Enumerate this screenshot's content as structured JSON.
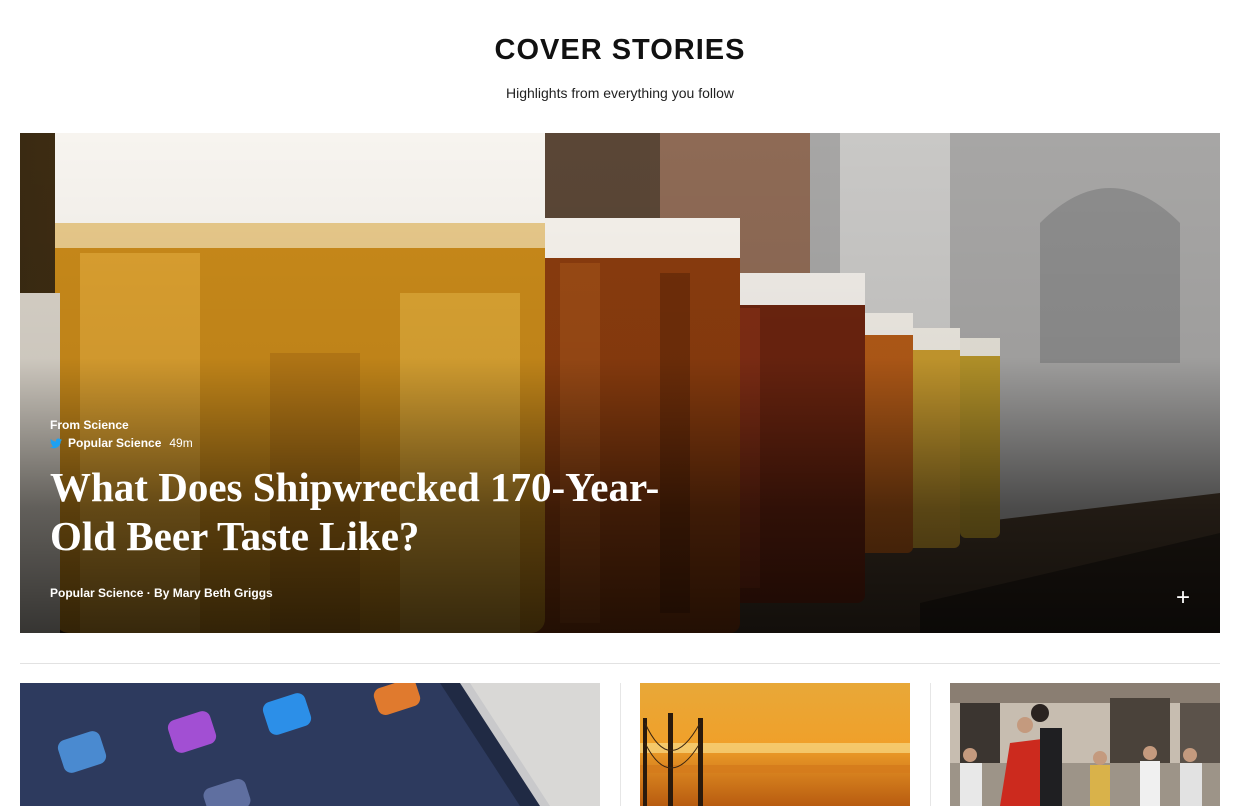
{
  "header": {
    "title": "COVER STORIES",
    "subtitle": "Highlights from everything you follow"
  },
  "hero": {
    "source": "From Science",
    "origin": {
      "icon": "twitter-icon",
      "name": "Popular Science",
      "time": "49m"
    },
    "title": "What Does Shipwrecked 170-Year-Old Beer Taste Like?",
    "byline": "Popular Science · By Mary Beth Griggs",
    "add_label": "+"
  },
  "cards": [
    {
      "image": "tablet-apps-photo"
    },
    {
      "image": "sunset-bridge-photo"
    },
    {
      "image": "street-dancers-photo"
    }
  ],
  "colors": {
    "twitter": "#1da1f2",
    "text_on_image": "#ffffff",
    "divider": "#e2e2e2"
  }
}
